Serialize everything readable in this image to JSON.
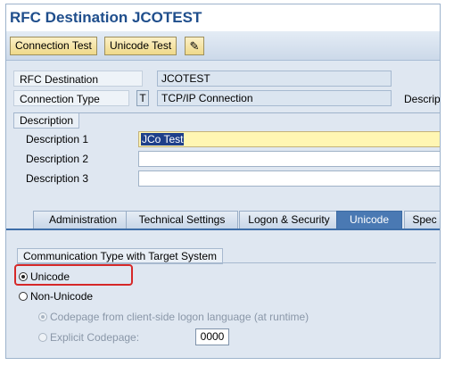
{
  "window": {
    "title": "RFC Destination JCOTEST"
  },
  "toolbar": {
    "connection_test": "Connection Test",
    "unicode_test": "Unicode Test",
    "edit_icon": "pencil-glasses-icon"
  },
  "header_fields": {
    "rfc_destination_label": "RFC Destination",
    "rfc_destination_value": "JCOTEST",
    "connection_type_label": "Connection Type",
    "connection_type_code": "T",
    "connection_type_value": "TCP/IP Connection",
    "description_cut_label": "Descrip"
  },
  "description": {
    "section_title": "Description",
    "items": [
      {
        "label": "Description 1",
        "value": "JCo Test"
      },
      {
        "label": "Description 2",
        "value": ""
      },
      {
        "label": "Description 3",
        "value": ""
      }
    ]
  },
  "tabs": [
    {
      "label": "Administration",
      "active": false
    },
    {
      "label": "Technical Settings",
      "active": false
    },
    {
      "label": "Logon & Security",
      "active": false
    },
    {
      "label": "Unicode",
      "active": true
    },
    {
      "label": "Spec",
      "active": false
    }
  ],
  "unicode_tab": {
    "group_title": "Communication Type with Target System",
    "unicode_label": "Unicode",
    "non_unicode_label": "Non-Unicode",
    "codepage_client_label": "Codepage from client-side logon language (at runtime)",
    "explicit_codepage_label": "Explicit Codepage:",
    "explicit_codepage_value": "0000"
  },
  "colors": {
    "title": "#1f4e8c",
    "active_tab": "#4a79b3",
    "highlight_border": "#d62828",
    "button_bg": "#efd98a"
  }
}
